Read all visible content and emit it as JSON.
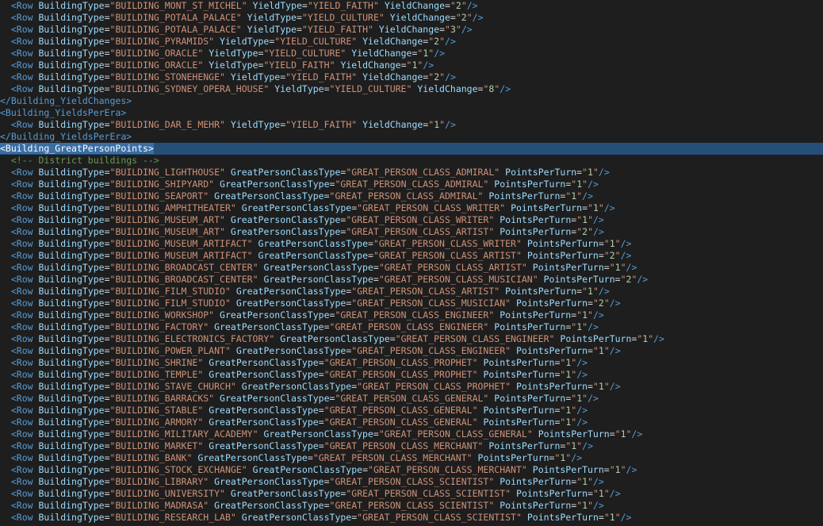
{
  "editor": {
    "highlighted_line": 12,
    "lines": [
      {
        "indent": 1,
        "kind": "row",
        "attrs": [
          [
            "BuildingType",
            "BUILDING_MONT_ST_MICHEL"
          ],
          [
            "YieldType",
            "YIELD_FAITH"
          ],
          [
            "YieldChange",
            "2"
          ]
        ]
      },
      {
        "indent": 1,
        "kind": "row",
        "attrs": [
          [
            "BuildingType",
            "BUILDING_POTALA_PALACE"
          ],
          [
            "YieldType",
            "YIELD_CULTURE"
          ],
          [
            "YieldChange",
            "2"
          ]
        ]
      },
      {
        "indent": 1,
        "kind": "row",
        "attrs": [
          [
            "BuildingType",
            "BUILDING_POTALA_PALACE"
          ],
          [
            "YieldType",
            "YIELD_FAITH"
          ],
          [
            "YieldChange",
            "3"
          ]
        ]
      },
      {
        "indent": 1,
        "kind": "row",
        "attrs": [
          [
            "BuildingType",
            "BUILDING_PYRAMIDS"
          ],
          [
            "YieldType",
            "YIELD_CULTURE"
          ],
          [
            "YieldChange",
            "2"
          ]
        ]
      },
      {
        "indent": 1,
        "kind": "row",
        "attrs": [
          [
            "BuildingType",
            "BUILDING_ORACLE"
          ],
          [
            "YieldType",
            "YIELD_CULTURE"
          ],
          [
            "YieldChange",
            "1"
          ]
        ]
      },
      {
        "indent": 1,
        "kind": "row",
        "attrs": [
          [
            "BuildingType",
            "BUILDING_ORACLE"
          ],
          [
            "YieldType",
            "YIELD_FAITH"
          ],
          [
            "YieldChange",
            "1"
          ]
        ]
      },
      {
        "indent": 1,
        "kind": "row",
        "attrs": [
          [
            "BuildingType",
            "BUILDING_STONEHENGE"
          ],
          [
            "YieldType",
            "YIELD_FAITH"
          ],
          [
            "YieldChange",
            "2"
          ]
        ]
      },
      {
        "indent": 1,
        "kind": "row",
        "attrs": [
          [
            "BuildingType",
            "BUILDING_SYDNEY_OPERA_HOUSE"
          ],
          [
            "YieldType",
            "YIELD_CULTURE"
          ],
          [
            "YieldChange",
            "8"
          ]
        ]
      },
      {
        "indent": 0,
        "kind": "close",
        "tag": "Building_YieldChanges"
      },
      {
        "indent": 0,
        "kind": "open",
        "tag": "Building_YieldsPerEra"
      },
      {
        "indent": 1,
        "kind": "row",
        "attrs": [
          [
            "BuildingType",
            "BUILDING_DAR_E_MEHR"
          ],
          [
            "YieldType",
            "YIELD_FAITH"
          ],
          [
            "YieldChange",
            "1"
          ]
        ]
      },
      {
        "indent": 0,
        "kind": "close",
        "tag": "Building_YieldsPerEra"
      },
      {
        "indent": 0,
        "kind": "open",
        "tag": "Building_GreatPersonPoints",
        "selected": true
      },
      {
        "indent": 1,
        "kind": "comment",
        "text": "<!-- District buildings -->"
      },
      {
        "indent": 1,
        "kind": "row",
        "attrs": [
          [
            "BuildingType",
            "BUILDING_LIGHTHOUSE"
          ],
          [
            "GreatPersonClassType",
            "GREAT_PERSON_CLASS_ADMIRAL"
          ],
          [
            "PointsPerTurn",
            "1"
          ]
        ]
      },
      {
        "indent": 1,
        "kind": "row",
        "attrs": [
          [
            "BuildingType",
            "BUILDING_SHIPYARD"
          ],
          [
            "GreatPersonClassType",
            "GREAT_PERSON_CLASS_ADMIRAL"
          ],
          [
            "PointsPerTurn",
            "1"
          ]
        ]
      },
      {
        "indent": 1,
        "kind": "row",
        "attrs": [
          [
            "BuildingType",
            "BUILDING_SEAPORT"
          ],
          [
            "GreatPersonClassType",
            "GREAT_PERSON_CLASS_ADMIRAL"
          ],
          [
            "PointsPerTurn",
            "1"
          ]
        ]
      },
      {
        "indent": 1,
        "kind": "row",
        "attrs": [
          [
            "BuildingType",
            "BUILDING_AMPHITHEATER"
          ],
          [
            "GreatPersonClassType",
            "GREAT_PERSON_CLASS_WRITER"
          ],
          [
            "PointsPerTurn",
            "1"
          ]
        ]
      },
      {
        "indent": 1,
        "kind": "row",
        "attrs": [
          [
            "BuildingType",
            "BUILDING_MUSEUM_ART"
          ],
          [
            "GreatPersonClassType",
            "GREAT_PERSON_CLASS_WRITER"
          ],
          [
            "PointsPerTurn",
            "1"
          ]
        ]
      },
      {
        "indent": 1,
        "kind": "row",
        "attrs": [
          [
            "BuildingType",
            "BUILDING_MUSEUM_ART"
          ],
          [
            "GreatPersonClassType",
            "GREAT_PERSON_CLASS_ARTIST"
          ],
          [
            "PointsPerTurn",
            "2"
          ]
        ]
      },
      {
        "indent": 1,
        "kind": "row",
        "attrs": [
          [
            "BuildingType",
            "BUILDING_MUSEUM_ARTIFACT"
          ],
          [
            "GreatPersonClassType",
            "GREAT_PERSON_CLASS_WRITER"
          ],
          [
            "PointsPerTurn",
            "1"
          ]
        ]
      },
      {
        "indent": 1,
        "kind": "row",
        "attrs": [
          [
            "BuildingType",
            "BUILDING_MUSEUM_ARTIFACT"
          ],
          [
            "GreatPersonClassType",
            "GREAT_PERSON_CLASS_ARTIST"
          ],
          [
            "PointsPerTurn",
            "2"
          ]
        ]
      },
      {
        "indent": 1,
        "kind": "row",
        "attrs": [
          [
            "BuildingType",
            "BUILDING_BROADCAST_CENTER"
          ],
          [
            "GreatPersonClassType",
            "GREAT_PERSON_CLASS_ARTIST"
          ],
          [
            "PointsPerTurn",
            "1"
          ]
        ]
      },
      {
        "indent": 1,
        "kind": "row",
        "attrs": [
          [
            "BuildingType",
            "BUILDING_BROADCAST_CENTER"
          ],
          [
            "GreatPersonClassType",
            "GREAT_PERSON_CLASS_MUSICIAN"
          ],
          [
            "PointsPerTurn",
            "2"
          ]
        ]
      },
      {
        "indent": 1,
        "kind": "row",
        "attrs": [
          [
            "BuildingType",
            "BUILDING_FILM_STUDIO"
          ],
          [
            "GreatPersonClassType",
            "GREAT_PERSON_CLASS_ARTIST"
          ],
          [
            "PointsPerTurn",
            "1"
          ]
        ]
      },
      {
        "indent": 1,
        "kind": "row",
        "attrs": [
          [
            "BuildingType",
            "BUILDING_FILM_STUDIO"
          ],
          [
            "GreatPersonClassType",
            "GREAT_PERSON_CLASS_MUSICIAN"
          ],
          [
            "PointsPerTurn",
            "2"
          ]
        ]
      },
      {
        "indent": 1,
        "kind": "row",
        "attrs": [
          [
            "BuildingType",
            "BUILDING_WORKSHOP"
          ],
          [
            "GreatPersonClassType",
            "GREAT_PERSON_CLASS_ENGINEER"
          ],
          [
            "PointsPerTurn",
            "1"
          ]
        ]
      },
      {
        "indent": 1,
        "kind": "row",
        "attrs": [
          [
            "BuildingType",
            "BUILDING_FACTORY"
          ],
          [
            "GreatPersonClassType",
            "GREAT_PERSON_CLASS_ENGINEER"
          ],
          [
            "PointsPerTurn",
            "1"
          ]
        ]
      },
      {
        "indent": 1,
        "kind": "row",
        "attrs": [
          [
            "BuildingType",
            "BUILDING_ELECTRONICS_FACTORY"
          ],
          [
            "GreatPersonClassType",
            "GREAT_PERSON_CLASS_ENGINEER"
          ],
          [
            "PointsPerTurn",
            "1"
          ]
        ]
      },
      {
        "indent": 1,
        "kind": "row",
        "attrs": [
          [
            "BuildingType",
            "BUILDING_POWER_PLANT"
          ],
          [
            "GreatPersonClassType",
            "GREAT_PERSON_CLASS_ENGINEER"
          ],
          [
            "PointsPerTurn",
            "1"
          ]
        ]
      },
      {
        "indent": 1,
        "kind": "row",
        "attrs": [
          [
            "BuildingType",
            "BUILDING_SHRINE"
          ],
          [
            "GreatPersonClassType",
            "GREAT_PERSON_CLASS_PROPHET"
          ],
          [
            "PointsPerTurn",
            "1"
          ]
        ]
      },
      {
        "indent": 1,
        "kind": "row",
        "attrs": [
          [
            "BuildingType",
            "BUILDING_TEMPLE"
          ],
          [
            "GreatPersonClassType",
            "GREAT_PERSON_CLASS_PROPHET"
          ],
          [
            "PointsPerTurn",
            "1"
          ]
        ]
      },
      {
        "indent": 1,
        "kind": "row",
        "attrs": [
          [
            "BuildingType",
            "BUILDING_STAVE_CHURCH"
          ],
          [
            "GreatPersonClassType",
            "GREAT_PERSON_CLASS_PROPHET"
          ],
          [
            "PointsPerTurn",
            "1"
          ]
        ]
      },
      {
        "indent": 1,
        "kind": "row",
        "attrs": [
          [
            "BuildingType",
            "BUILDING_BARRACKS"
          ],
          [
            "GreatPersonClassType",
            "GREAT_PERSON_CLASS_GENERAL"
          ],
          [
            "PointsPerTurn",
            "1"
          ]
        ]
      },
      {
        "indent": 1,
        "kind": "row",
        "attrs": [
          [
            "BuildingType",
            "BUILDING_STABLE"
          ],
          [
            "GreatPersonClassType",
            "GREAT_PERSON_CLASS_GENERAL"
          ],
          [
            "PointsPerTurn",
            "1"
          ]
        ]
      },
      {
        "indent": 1,
        "kind": "row",
        "attrs": [
          [
            "BuildingType",
            "BUILDING_ARMORY"
          ],
          [
            "GreatPersonClassType",
            "GREAT_PERSON_CLASS_GENERAL"
          ],
          [
            "PointsPerTurn",
            "1"
          ]
        ]
      },
      {
        "indent": 1,
        "kind": "row",
        "attrs": [
          [
            "BuildingType",
            "BUILDING_MILITARY_ACADEMY"
          ],
          [
            "GreatPersonClassType",
            "GREAT_PERSON_CLASS_GENERAL"
          ],
          [
            "PointsPerTurn",
            "1"
          ]
        ]
      },
      {
        "indent": 1,
        "kind": "row",
        "attrs": [
          [
            "BuildingType",
            "BUILDING_MARKET"
          ],
          [
            "GreatPersonClassType",
            "GREAT_PERSON_CLASS_MERCHANT"
          ],
          [
            "PointsPerTurn",
            "1"
          ]
        ]
      },
      {
        "indent": 1,
        "kind": "row",
        "attrs": [
          [
            "BuildingType",
            "BUILDING_BANK"
          ],
          [
            "GreatPersonClassType",
            "GREAT_PERSON_CLASS_MERCHANT"
          ],
          [
            "PointsPerTurn",
            "1"
          ]
        ]
      },
      {
        "indent": 1,
        "kind": "row",
        "attrs": [
          [
            "BuildingType",
            "BUILDING_STOCK_EXCHANGE"
          ],
          [
            "GreatPersonClassType",
            "GREAT_PERSON_CLASS_MERCHANT"
          ],
          [
            "PointsPerTurn",
            "1"
          ]
        ]
      },
      {
        "indent": 1,
        "kind": "row",
        "attrs": [
          [
            "BuildingType",
            "BUILDING_LIBRARY"
          ],
          [
            "GreatPersonClassType",
            "GREAT_PERSON_CLASS_SCIENTIST"
          ],
          [
            "PointsPerTurn",
            "1"
          ]
        ]
      },
      {
        "indent": 1,
        "kind": "row",
        "attrs": [
          [
            "BuildingType",
            "BUILDING_UNIVERSITY"
          ],
          [
            "GreatPersonClassType",
            "GREAT_PERSON_CLASS_SCIENTIST"
          ],
          [
            "PointsPerTurn",
            "1"
          ]
        ]
      },
      {
        "indent": 1,
        "kind": "row",
        "attrs": [
          [
            "BuildingType",
            "BUILDING_MADRASA"
          ],
          [
            "GreatPersonClassType",
            "GREAT_PERSON_CLASS_SCIENTIST"
          ],
          [
            "PointsPerTurn",
            "1"
          ]
        ]
      },
      {
        "indent": 1,
        "kind": "row",
        "attrs": [
          [
            "BuildingType",
            "BUILDING_RESEARCH_LAB"
          ],
          [
            "GreatPersonClassType",
            "GREAT_PERSON_CLASS_SCIENTIST"
          ],
          [
            "PointsPerTurn",
            "1"
          ]
        ]
      }
    ]
  },
  "colors": {
    "background": "#1e1e1e",
    "tag": "#569cd6",
    "attribute": "#9cdcfe",
    "string": "#ce9178",
    "number": "#b5cea8",
    "comment": "#6a9955",
    "line_highlight": "#264f78"
  }
}
